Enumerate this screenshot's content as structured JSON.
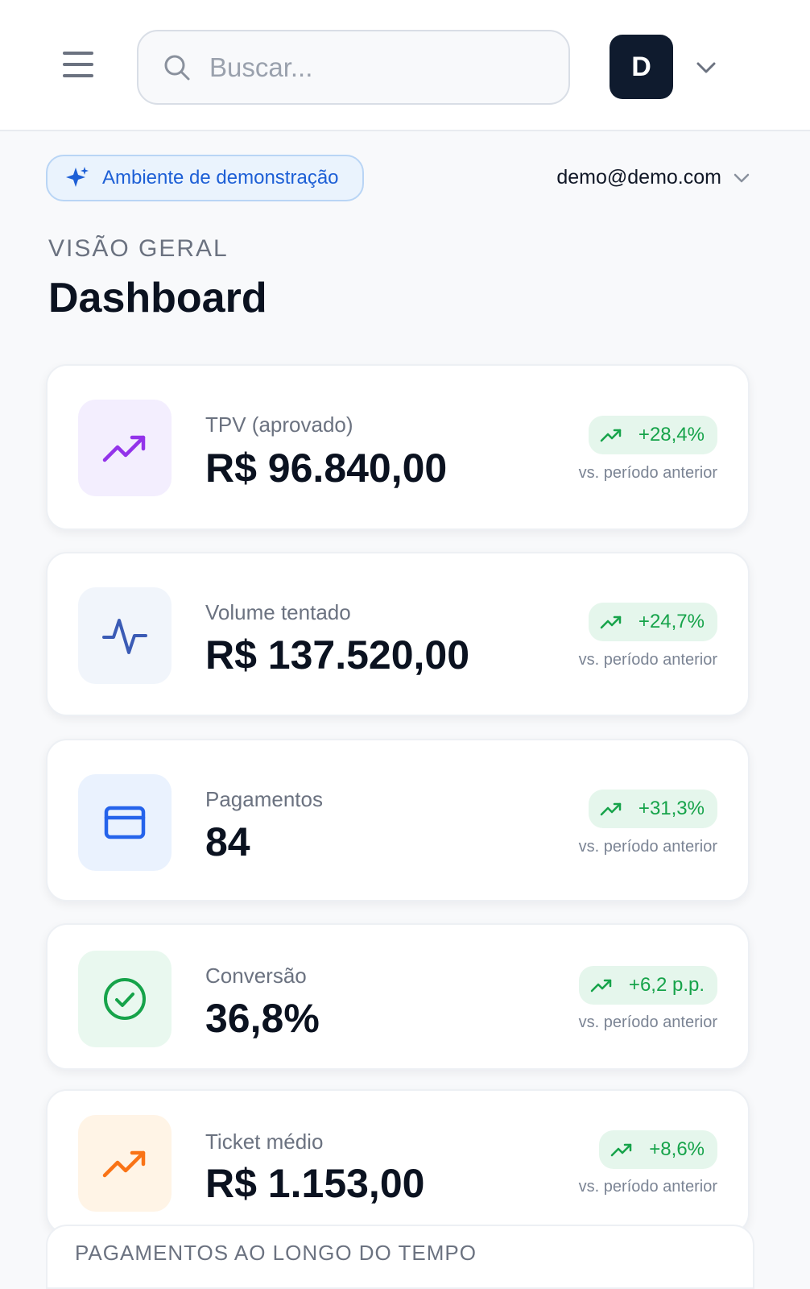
{
  "header": {
    "menu_icon": "hamburger-menu-icon",
    "search": {
      "placeholder": "Buscar...",
      "value": ""
    },
    "avatar_initial": "D"
  },
  "environment": {
    "badge_label": "Ambiente de demonstração",
    "badge_icon": "sparkle-icon"
  },
  "user": {
    "email": "demo@demo.com"
  },
  "page": {
    "section_label": "VISÃO GERAL",
    "title": "Dashboard"
  },
  "metrics": [
    {
      "label": "TPV (aprovado)",
      "value": "R$ 96.840,00",
      "delta": "+28,4%",
      "compare": "vs. período anterior",
      "icon": "trending-up-icon",
      "icon_color": "#9333ea",
      "icon_bg": "#f3eefe"
    },
    {
      "label": "Volume tentado",
      "value": "R$ 137.520,00",
      "delta": "+24,7%",
      "compare": "vs. período anterior",
      "icon": "activity-icon",
      "icon_color": "#3b5bb5",
      "icon_bg": "#f1f5fb"
    },
    {
      "label": "Pagamentos",
      "value": "84",
      "delta": "+31,3%",
      "compare": "vs. período anterior",
      "icon": "credit-card-icon",
      "icon_color": "#2563eb",
      "icon_bg": "#eaf2fe"
    },
    {
      "label": "Conversão",
      "value": "36,8%",
      "delta": "+6,2 p.p.",
      "compare": "vs. período anterior",
      "icon": "check-circle-icon",
      "icon_color": "#16a34a",
      "icon_bg": "#e9f8ef"
    },
    {
      "label": "Ticket médio",
      "value": "R$ 1.153,00",
      "delta": "+8,6%",
      "compare": "vs. período anterior",
      "icon": "trending-up-icon",
      "icon_color": "#f97316",
      "icon_bg": "#fff4e6"
    }
  ],
  "chart_section": {
    "title": "PAGAMENTOS AO LONGO DO TEMPO"
  },
  "colors": {
    "accent_blue": "#1d5fd6",
    "positive_green": "#16a34a",
    "dark": "#0b1220"
  }
}
